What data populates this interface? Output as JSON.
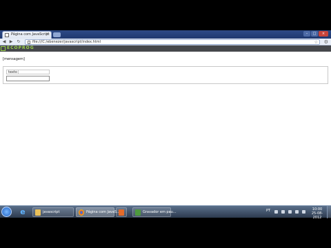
{
  "browser": {
    "tab_title": "Página com JavaScript",
    "tab_close": "×",
    "url": "file:///C:/ebenezer/javascript/index.html",
    "window_controls": {
      "minimize": "–",
      "maximize": "□",
      "close": "×"
    },
    "nav": {
      "back": "◀",
      "forward": "▶",
      "reload": "↻"
    },
    "star_icon": "☆",
    "wrench_icon": "⚙"
  },
  "banner": {
    "logo_text": "ECOPROG"
  },
  "page": {
    "message": "[mensagem]",
    "field_legend": "texto",
    "input_value": ""
  },
  "taskbar": {
    "tasks": [
      {
        "label": "javascript"
      },
      {
        "label": "Página com JavaS..."
      },
      {
        "label": ""
      },
      {
        "label": "Gravador em pau..."
      }
    ],
    "tray_lang": "PT",
    "clock_time": "10:00",
    "clock_date": "25-08-2012"
  },
  "colors": {
    "accent_green": "#9ad04b",
    "titlebar": "#2d4a86",
    "taskbar": "#2c3a4e"
  }
}
